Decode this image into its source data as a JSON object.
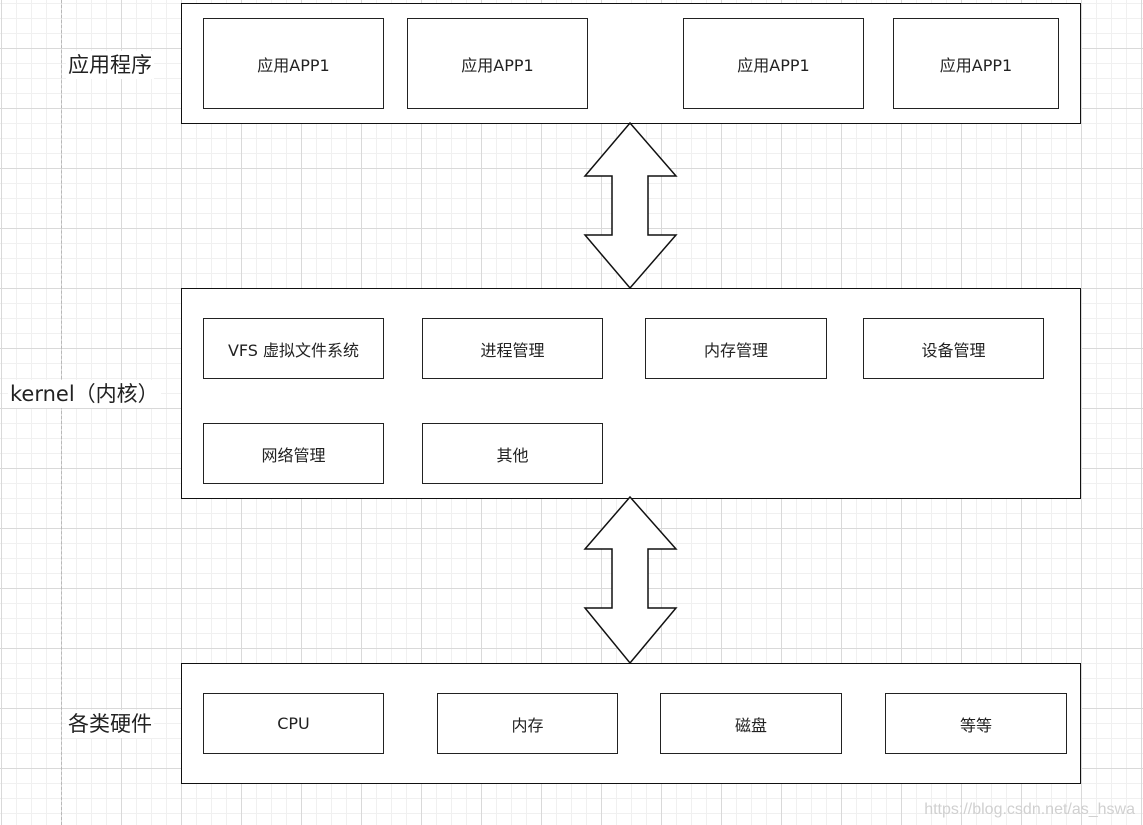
{
  "layers": {
    "apps": {
      "label": "应用程序",
      "items": [
        "应用APP1",
        "应用APP1",
        "应用APP1",
        "应用APP1"
      ]
    },
    "kernel": {
      "label": "kernel（内核）",
      "items": [
        "VFS 虚拟文件系统",
        "进程管理",
        "内存管理",
        "设备管理",
        "网络管理",
        "其他"
      ]
    },
    "hardware": {
      "label": "各类硬件",
      "items": [
        "CPU",
        "内存",
        "磁盘",
        "等等"
      ]
    }
  },
  "connectors": [
    {
      "from": "apps",
      "to": "kernel",
      "type": "bidirectional-arrow"
    },
    {
      "from": "kernel",
      "to": "hardware",
      "type": "bidirectional-arrow"
    }
  ],
  "watermark": "https://blog.csdn.net/as_hswa"
}
